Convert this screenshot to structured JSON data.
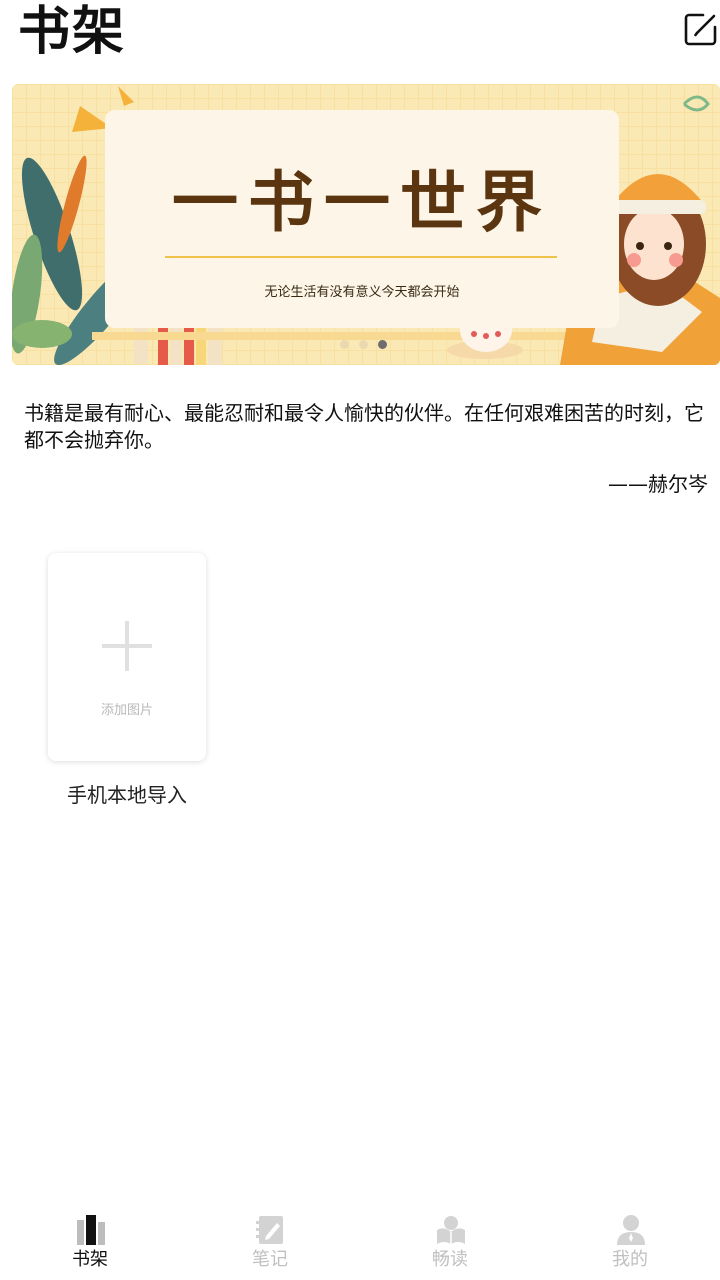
{
  "header": {
    "title": "书架",
    "edit_icon": "edit-icon"
  },
  "banner": {
    "title": "一书一世界",
    "subtitle": "无论生活有没有意义今天都会开始",
    "slide_count": 3,
    "active_slide": 3,
    "colors": {
      "background": "#fbe9b5",
      "card": "#fdf6e8",
      "title": "#5a3510",
      "accent": "#f0c14b"
    }
  },
  "quote": {
    "text": "书籍是最有耐心、最能忍耐和最令人愉快的伙伴。在任何艰难困苦的时刻，它都不会抛弃你。",
    "author": "——赫尔岑"
  },
  "shelf": {
    "add_card_label": "添加图片",
    "add_card_icon": "plus-icon",
    "import_label": "手机本地导入"
  },
  "tabbar": {
    "active_color": "#111111",
    "inactive_color": "#c0c0c0",
    "tabs": [
      {
        "label": "书架",
        "icon": "bookshelf-icon",
        "active": true
      },
      {
        "label": "笔记",
        "icon": "note-icon",
        "active": false
      },
      {
        "label": "畅读",
        "icon": "reading-icon",
        "active": false
      },
      {
        "label": "我的",
        "icon": "user-icon",
        "active": false
      }
    ]
  }
}
